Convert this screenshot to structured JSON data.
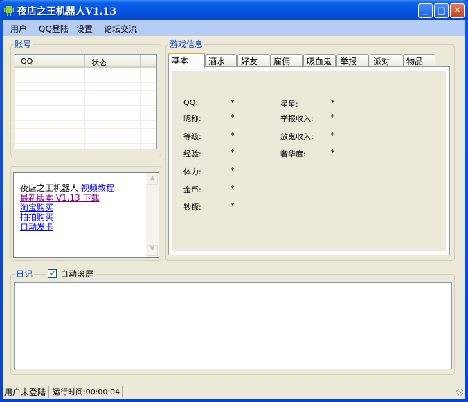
{
  "window": {
    "title": "夜店之王机器人V1.13",
    "minimize": "_",
    "maximize": "□",
    "close": "✕"
  },
  "menu": [
    "用户",
    "QQ登陆",
    "设置",
    "论坛交流"
  ],
  "account": {
    "title": "账号",
    "columns": [
      "QQ",
      "状态"
    ]
  },
  "links": {
    "intro": "夜店之王机器人",
    "video": "视频教程",
    "latest": "最新版本 V1.13 下载",
    "taobao": "淘宝购买",
    "paipai": "拍拍购买",
    "autocard": "自动发卡"
  },
  "game": {
    "title": "游戏信息",
    "tabs": [
      "基本",
      "酒水",
      "好友",
      "雇佣",
      "吸血鬼",
      "举报",
      "派对",
      "物品"
    ],
    "left": [
      {
        "label": "QQ:",
        "value": "*"
      },
      {
        "label": "昵称:",
        "value": "*"
      },
      {
        "label": "等级:",
        "value": "*"
      },
      {
        "label": "经验:",
        "value": "*"
      },
      {
        "label": "体力:",
        "value": "*"
      },
      {
        "label": "金币:",
        "value": "*"
      },
      {
        "label": "钞镖:",
        "value": "*"
      }
    ],
    "right": [
      {
        "label": "星星:",
        "value": "*"
      },
      {
        "label": "举报收入:",
        "value": "*"
      },
      {
        "label": "放鬼收入:",
        "value": "*"
      },
      {
        "label": "奢华度:",
        "value": "*"
      }
    ]
  },
  "log": {
    "title": "日记",
    "autoscroll": "自动滚屏",
    "autoscroll_checked": true
  },
  "status": {
    "login": "用户未登陆",
    "runtime": "运行时间:00:00:04"
  }
}
